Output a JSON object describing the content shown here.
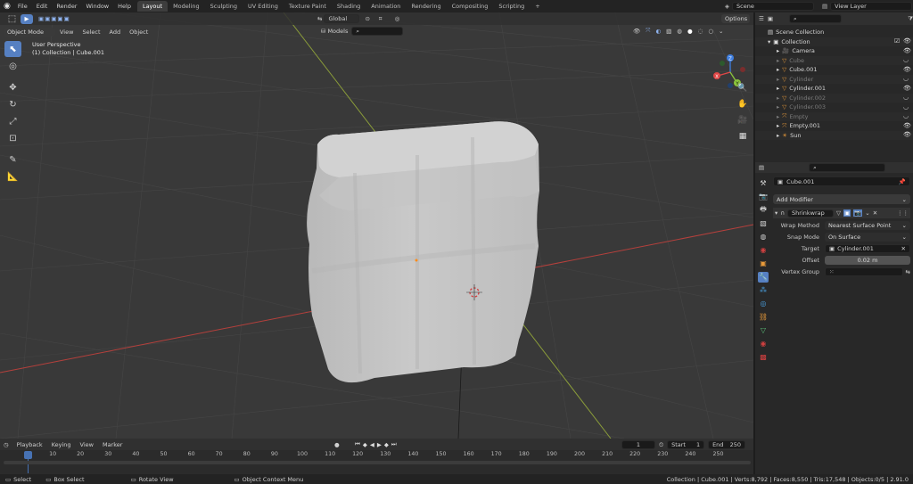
{
  "topbar": {
    "menus": [
      "File",
      "Edit",
      "Render",
      "Window",
      "Help"
    ],
    "workspaces": [
      "Layout",
      "Modeling",
      "Sculpting",
      "UV Editing",
      "Texture Paint",
      "Shading",
      "Animation",
      "Rendering",
      "Compositing",
      "Scripting"
    ],
    "active_workspace": "Layout",
    "add_tab": "+",
    "scene": "Scene",
    "view_layer": "View Layer"
  },
  "viewport": {
    "mode": "Object Mode",
    "menus": [
      "View",
      "Select",
      "Add",
      "Object"
    ],
    "orientation": "Global",
    "models_label": "Models",
    "options_label": "Options",
    "perspective": "User Perspective",
    "context": "(1) Collection | Cube.001",
    "gizmo": {
      "z": "Z",
      "y": "Y",
      "x": "X"
    }
  },
  "outliner": {
    "scene_collection": "Scene Collection",
    "collection": "Collection",
    "items": [
      {
        "name": "Camera",
        "dim": false
      },
      {
        "name": "Cube",
        "dim": true
      },
      {
        "name": "Cube.001",
        "dim": false
      },
      {
        "name": "Cylinder",
        "dim": true
      },
      {
        "name": "Cylinder.001",
        "dim": false
      },
      {
        "name": "Cylinder.002",
        "dim": true
      },
      {
        "name": "Cylinder.003",
        "dim": true
      },
      {
        "name": "Empty",
        "dim": true
      },
      {
        "name": "Empty.001",
        "dim": false
      },
      {
        "name": "Sun",
        "dim": false
      }
    ]
  },
  "properties": {
    "object_name": "Cube.001",
    "add_modifier": "Add Modifier",
    "modifier_name": "Shrinkwrap",
    "wrap_method_label": "Wrap Method",
    "wrap_method_value": "Nearest Surface Point",
    "snap_mode_label": "Snap Mode",
    "snap_mode_value": "On Surface",
    "target_label": "Target",
    "target_value": "Cylinder.001",
    "offset_label": "Offset",
    "offset_value": "0.02 m",
    "vertex_group_label": "Vertex Group"
  },
  "timeline": {
    "menus": [
      "Playback",
      "Keying",
      "View",
      "Marker"
    ],
    "current_frame": "1",
    "start_label": "Start",
    "start_value": "1",
    "end_label": "End",
    "end_value": "250",
    "ticks": [
      "1",
      "10",
      "20",
      "30",
      "40",
      "50",
      "60",
      "70",
      "80",
      "90",
      "100",
      "110",
      "120",
      "130",
      "140",
      "150",
      "160",
      "170",
      "180",
      "190",
      "200",
      "210",
      "220",
      "230",
      "240",
      "250"
    ]
  },
  "statusbar": {
    "select": "Select",
    "box_select": "Box Select",
    "rotate_view": "Rotate View",
    "context_menu": "Object Context Menu",
    "stats": "Collection | Cube.001 | Verts:8,792 | Faces:8,550 | Tris:17,548 | Objects:0/5 | 2.91.0"
  },
  "colors": {
    "accent": "#5680c2",
    "viewport_bg": "#393939",
    "panel_bg": "#282828",
    "header_bg": "#232323",
    "axis_x": "#e04646",
    "axis_y": "#8ac43c",
    "axis_z": "#3f7fe0",
    "mesh": "#c6c6c6"
  }
}
